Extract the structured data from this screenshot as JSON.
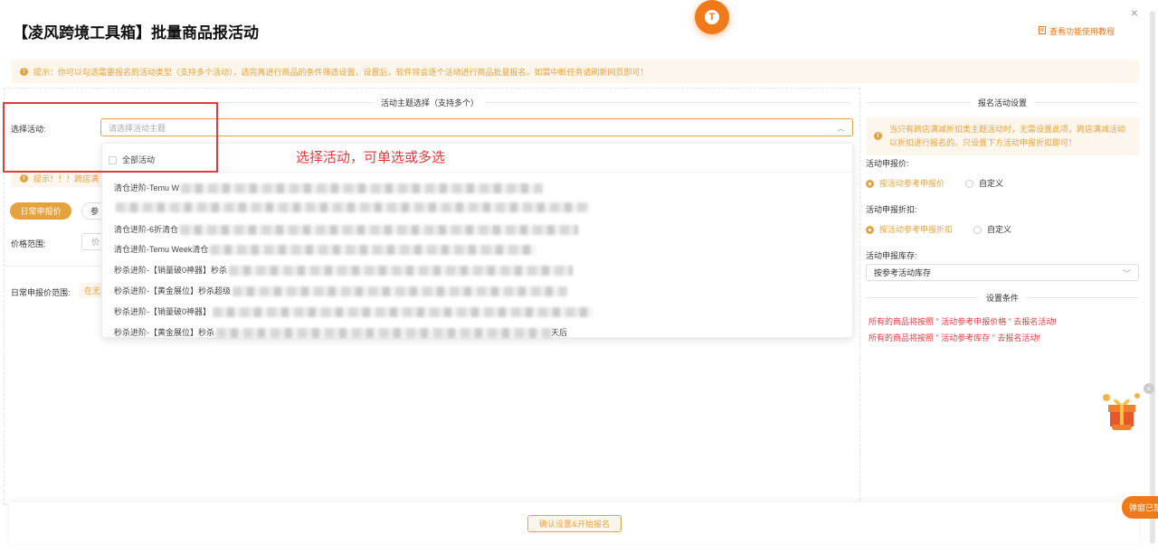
{
  "header": {
    "title": "【凌风跨境工具箱】批量商品报活动",
    "tutorial_link": "查看功能使用教程",
    "close_symbol": "×",
    "logo_letter": "T"
  },
  "tip_bar": {
    "text": "提示：你可以勾选需要报名的活动类型（支持多个活动），选完再进行商品的条件筛选设置，设置后，软件将会逐个活动进行商品批量报名。如需中断任务请刷新网页即可！"
  },
  "left": {
    "section_title": "活动主题选择（支持多个）",
    "select_label": "选择活动:",
    "select_placeholder": "请选择活动主题",
    "dropdown": {
      "all_label": "全部活动",
      "items": [
        "清仓进阶-Temu W",
        "",
        "清仓进阶-6折清仓",
        "清仓进阶-Temu Week清仓",
        "秒杀进阶-【销量破0神器】秒杀",
        "秒杀进阶-【黄金展位】秒杀超级",
        "秒杀进阶-【销量破0神器】",
        "秒杀进阶-【黄金展位】秒杀"
      ],
      "last_item_suffix": "天后"
    },
    "annotation": "选择活动，可单选或多选",
    "tip2": "提示！！！跨店满",
    "daily_price_tab": "日常申报价",
    "ref_tab": "参",
    "price_range_label": "价格范围:",
    "price_input_placeholder": "价",
    "daily_range_label": "日常申报价范围:",
    "range_tag": "在无"
  },
  "right": {
    "section_title": "报名活动设置",
    "tip": "当只有跨店满减折扣类主题活动时，无需设置此项，跨店满减活动以折扣进行报名的。只设置下方活动申报折扣即可！",
    "price_label": "活动申报价:",
    "price_option_ref": "按活动参考申报价",
    "price_option_custom": "自定义",
    "discount_label": "活动申报折扣:",
    "discount_option_ref": "按活动参考申报折扣",
    "discount_option_custom": "自定义",
    "stock_label": "活动申报库存:",
    "stock_value": "按参考活动库存",
    "conditions_title": "设置条件",
    "note1": "所有的商品将按照 \" 活动参考申报价格 \" 去报名活动!",
    "note2": "所有的商品将按照 \" 活动参考库存 \" 去报名活动!"
  },
  "footer": {
    "confirm_button": "确认设置&开始报名"
  },
  "float": {
    "popup_tab": "弹窗已禁"
  },
  "colors": {
    "accent": "#e6a23c",
    "brand_orange": "#f07a1a",
    "alert_red": "#e23b3b"
  }
}
